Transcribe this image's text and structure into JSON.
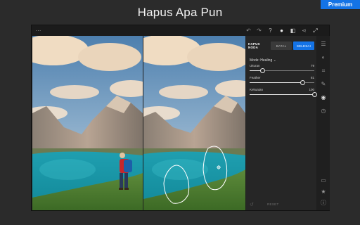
{
  "page": {
    "title": "Hapus Apa Pun",
    "premium_label": "Premium"
  },
  "panel": {
    "tabs": [
      "HAPUS NODA",
      "BATAL",
      "SELESAI"
    ],
    "mode_label": "Mode: Healing",
    "sliders": [
      {
        "label": "Ukuran",
        "value": "79",
        "fraction": 0.2
      },
      {
        "label": "Feather",
        "value": "81",
        "fraction": 0.82
      },
      {
        "label": "Kekuatan",
        "value": "100",
        "fraction": 1.0
      }
    ],
    "reset_label": "RESET"
  },
  "icons": {
    "topbar": [
      "undo-icon",
      "redo-icon",
      "help-icon",
      "check-circle-icon",
      "compare-icon",
      "share-icon",
      "fullscreen-icon"
    ],
    "rail": [
      "layers-icon",
      "adjust-icon",
      "crop-icon",
      "brush-icon",
      "heal-icon",
      "history-icon",
      "comment-icon",
      "star-icon",
      "info-icon"
    ]
  },
  "colors": {
    "accent": "#1473e6",
    "background": "#2b2b2b"
  }
}
